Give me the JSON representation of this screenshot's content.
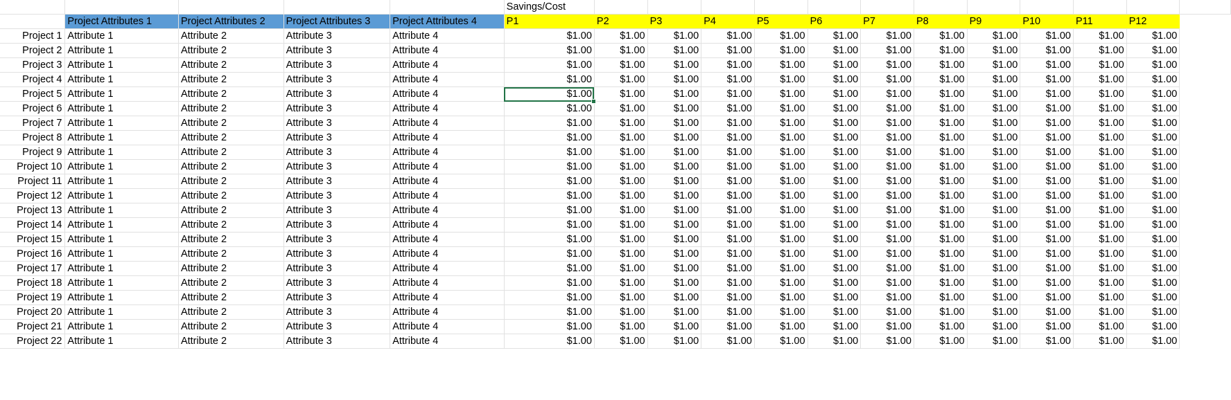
{
  "top_label": "Savings/Cost",
  "attribute_headers": [
    "Project Attributes 1",
    "Project Attributes 2",
    "Project Attributes 3",
    "Project Attributes 4"
  ],
  "period_headers": [
    "P1",
    "P2",
    "P3",
    "P4",
    "P5",
    "P6",
    "P7",
    "P8",
    "P9",
    "P10",
    "P11",
    "P12"
  ],
  "rows": [
    {
      "project": "Project 1",
      "attributes": [
        "Attribute 1",
        "Attribute 2",
        "Attribute 3",
        "Attribute 4"
      ],
      "values": [
        "$1.00",
        "$1.00",
        "$1.00",
        "$1.00",
        "$1.00",
        "$1.00",
        "$1.00",
        "$1.00",
        "$1.00",
        "$1.00",
        "$1.00",
        "$1.00"
      ]
    },
    {
      "project": "Project 2",
      "attributes": [
        "Attribute 1",
        "Attribute 2",
        "Attribute 3",
        "Attribute 4"
      ],
      "values": [
        "$1.00",
        "$1.00",
        "$1.00",
        "$1.00",
        "$1.00",
        "$1.00",
        "$1.00",
        "$1.00",
        "$1.00",
        "$1.00",
        "$1.00",
        "$1.00"
      ]
    },
    {
      "project": "Project 3",
      "attributes": [
        "Attribute 1",
        "Attribute 2",
        "Attribute 3",
        "Attribute 4"
      ],
      "values": [
        "$1.00",
        "$1.00",
        "$1.00",
        "$1.00",
        "$1.00",
        "$1.00",
        "$1.00",
        "$1.00",
        "$1.00",
        "$1.00",
        "$1.00",
        "$1.00"
      ]
    },
    {
      "project": "Project 4",
      "attributes": [
        "Attribute 1",
        "Attribute 2",
        "Attribute 3",
        "Attribute 4"
      ],
      "values": [
        "$1.00",
        "$1.00",
        "$1.00",
        "$1.00",
        "$1.00",
        "$1.00",
        "$1.00",
        "$1.00",
        "$1.00",
        "$1.00",
        "$1.00",
        "$1.00"
      ]
    },
    {
      "project": "Project 5",
      "attributes": [
        "Attribute 1",
        "Attribute 2",
        "Attribute 3",
        "Attribute 4"
      ],
      "values": [
        "$1.00",
        "$1.00",
        "$1.00",
        "$1.00",
        "$1.00",
        "$1.00",
        "$1.00",
        "$1.00",
        "$1.00",
        "$1.00",
        "$1.00",
        "$1.00"
      ]
    },
    {
      "project": "Project 6",
      "attributes": [
        "Attribute 1",
        "Attribute 2",
        "Attribute 3",
        "Attribute 4"
      ],
      "values": [
        "$1.00",
        "$1.00",
        "$1.00",
        "$1.00",
        "$1.00",
        "$1.00",
        "$1.00",
        "$1.00",
        "$1.00",
        "$1.00",
        "$1.00",
        "$1.00"
      ]
    },
    {
      "project": "Project 7",
      "attributes": [
        "Attribute 1",
        "Attribute 2",
        "Attribute 3",
        "Attribute 4"
      ],
      "values": [
        "$1.00",
        "$1.00",
        "$1.00",
        "$1.00",
        "$1.00",
        "$1.00",
        "$1.00",
        "$1.00",
        "$1.00",
        "$1.00",
        "$1.00",
        "$1.00"
      ]
    },
    {
      "project": "Project 8",
      "attributes": [
        "Attribute 1",
        "Attribute 2",
        "Attribute 3",
        "Attribute 4"
      ],
      "values": [
        "$1.00",
        "$1.00",
        "$1.00",
        "$1.00",
        "$1.00",
        "$1.00",
        "$1.00",
        "$1.00",
        "$1.00",
        "$1.00",
        "$1.00",
        "$1.00"
      ]
    },
    {
      "project": "Project 9",
      "attributes": [
        "Attribute 1",
        "Attribute 2",
        "Attribute 3",
        "Attribute 4"
      ],
      "values": [
        "$1.00",
        "$1.00",
        "$1.00",
        "$1.00",
        "$1.00",
        "$1.00",
        "$1.00",
        "$1.00",
        "$1.00",
        "$1.00",
        "$1.00",
        "$1.00"
      ]
    },
    {
      "project": "Project 10",
      "attributes": [
        "Attribute 1",
        "Attribute 2",
        "Attribute 3",
        "Attribute 4"
      ],
      "values": [
        "$1.00",
        "$1.00",
        "$1.00",
        "$1.00",
        "$1.00",
        "$1.00",
        "$1.00",
        "$1.00",
        "$1.00",
        "$1.00",
        "$1.00",
        "$1.00"
      ]
    },
    {
      "project": "Project 11",
      "attributes": [
        "Attribute 1",
        "Attribute 2",
        "Attribute 3",
        "Attribute 4"
      ],
      "values": [
        "$1.00",
        "$1.00",
        "$1.00",
        "$1.00",
        "$1.00",
        "$1.00",
        "$1.00",
        "$1.00",
        "$1.00",
        "$1.00",
        "$1.00",
        "$1.00"
      ]
    },
    {
      "project": "Project 12",
      "attributes": [
        "Attribute 1",
        "Attribute 2",
        "Attribute 3",
        "Attribute 4"
      ],
      "values": [
        "$1.00",
        "$1.00",
        "$1.00",
        "$1.00",
        "$1.00",
        "$1.00",
        "$1.00",
        "$1.00",
        "$1.00",
        "$1.00",
        "$1.00",
        "$1.00"
      ]
    },
    {
      "project": "Project 13",
      "attributes": [
        "Attribute 1",
        "Attribute 2",
        "Attribute 3",
        "Attribute 4"
      ],
      "values": [
        "$1.00",
        "$1.00",
        "$1.00",
        "$1.00",
        "$1.00",
        "$1.00",
        "$1.00",
        "$1.00",
        "$1.00",
        "$1.00",
        "$1.00",
        "$1.00"
      ]
    },
    {
      "project": "Project 14",
      "attributes": [
        "Attribute 1",
        "Attribute 2",
        "Attribute 3",
        "Attribute 4"
      ],
      "values": [
        "$1.00",
        "$1.00",
        "$1.00",
        "$1.00",
        "$1.00",
        "$1.00",
        "$1.00",
        "$1.00",
        "$1.00",
        "$1.00",
        "$1.00",
        "$1.00"
      ]
    },
    {
      "project": "Project 15",
      "attributes": [
        "Attribute 1",
        "Attribute 2",
        "Attribute 3",
        "Attribute 4"
      ],
      "values": [
        "$1.00",
        "$1.00",
        "$1.00",
        "$1.00",
        "$1.00",
        "$1.00",
        "$1.00",
        "$1.00",
        "$1.00",
        "$1.00",
        "$1.00",
        "$1.00"
      ]
    },
    {
      "project": "Project 16",
      "attributes": [
        "Attribute 1",
        "Attribute 2",
        "Attribute 3",
        "Attribute 4"
      ],
      "values": [
        "$1.00",
        "$1.00",
        "$1.00",
        "$1.00",
        "$1.00",
        "$1.00",
        "$1.00",
        "$1.00",
        "$1.00",
        "$1.00",
        "$1.00",
        "$1.00"
      ]
    },
    {
      "project": "Project 17",
      "attributes": [
        "Attribute 1",
        "Attribute 2",
        "Attribute 3",
        "Attribute 4"
      ],
      "values": [
        "$1.00",
        "$1.00",
        "$1.00",
        "$1.00",
        "$1.00",
        "$1.00",
        "$1.00",
        "$1.00",
        "$1.00",
        "$1.00",
        "$1.00",
        "$1.00"
      ]
    },
    {
      "project": "Project 18",
      "attributes": [
        "Attribute 1",
        "Attribute 2",
        "Attribute 3",
        "Attribute 4"
      ],
      "values": [
        "$1.00",
        "$1.00",
        "$1.00",
        "$1.00",
        "$1.00",
        "$1.00",
        "$1.00",
        "$1.00",
        "$1.00",
        "$1.00",
        "$1.00",
        "$1.00"
      ]
    },
    {
      "project": "Project 19",
      "attributes": [
        "Attribute 1",
        "Attribute 2",
        "Attribute 3",
        "Attribute 4"
      ],
      "values": [
        "$1.00",
        "$1.00",
        "$1.00",
        "$1.00",
        "$1.00",
        "$1.00",
        "$1.00",
        "$1.00",
        "$1.00",
        "$1.00",
        "$1.00",
        "$1.00"
      ]
    },
    {
      "project": "Project 20",
      "attributes": [
        "Attribute 1",
        "Attribute 2",
        "Attribute 3",
        "Attribute 4"
      ],
      "values": [
        "$1.00",
        "$1.00",
        "$1.00",
        "$1.00",
        "$1.00",
        "$1.00",
        "$1.00",
        "$1.00",
        "$1.00",
        "$1.00",
        "$1.00",
        "$1.00"
      ]
    },
    {
      "project": "Project 21",
      "attributes": [
        "Attribute 1",
        "Attribute 2",
        "Attribute 3",
        "Attribute 4"
      ],
      "values": [
        "$1.00",
        "$1.00",
        "$1.00",
        "$1.00",
        "$1.00",
        "$1.00",
        "$1.00",
        "$1.00",
        "$1.00",
        "$1.00",
        "$1.00",
        "$1.00"
      ]
    },
    {
      "project": "Project 22",
      "attributes": [
        "Attribute 1",
        "Attribute 2",
        "Attribute 3",
        "Attribute 4"
      ],
      "values": [
        "$1.00",
        "$1.00",
        "$1.00",
        "$1.00",
        "$1.00",
        "$1.00",
        "$1.00",
        "$1.00",
        "$1.00",
        "$1.00",
        "$1.00",
        "$1.00"
      ]
    }
  ],
  "selected_cell": {
    "row": 4,
    "col": 0
  },
  "colors": {
    "attribute_header_fill": "#5b9bd5",
    "period_header_fill": "#ffff00",
    "selection": "#217346",
    "gridline": "#e1e1e1"
  }
}
